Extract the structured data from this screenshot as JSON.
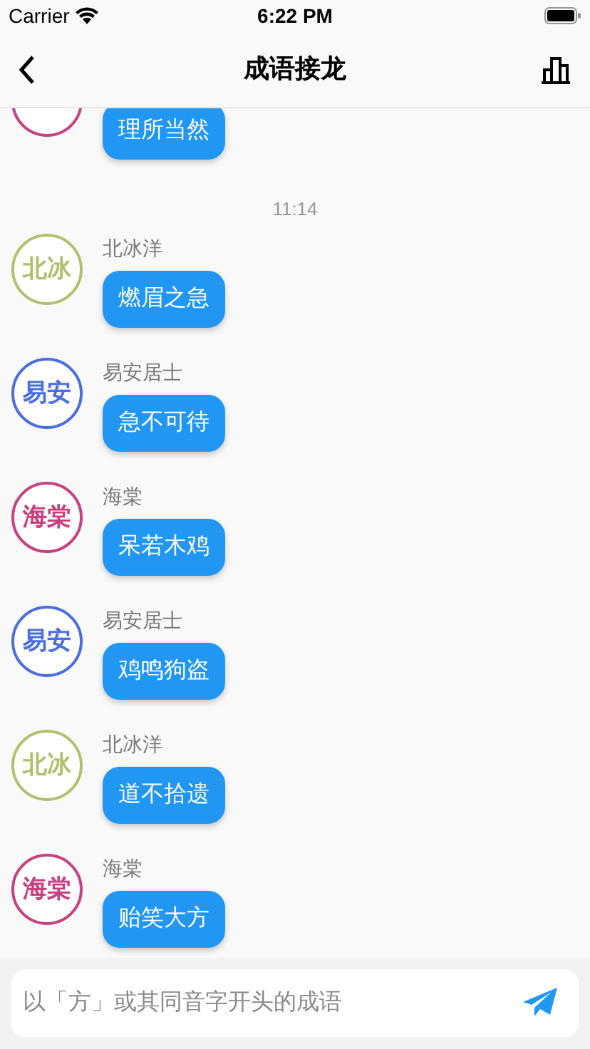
{
  "status_bar": {
    "carrier": "Carrier",
    "time": "6:22 PM"
  },
  "nav": {
    "title": "成语接龙"
  },
  "messages": [
    {
      "kind": "partial",
      "color": "#c8407f",
      "text": "理所当然"
    },
    {
      "kind": "time",
      "text": "11:14"
    },
    {
      "kind": "message",
      "avatar": "北冰",
      "name": "北冰洋",
      "color": "#b3bf6e",
      "text": "燃眉之急"
    },
    {
      "kind": "message",
      "avatar": "易安",
      "name": "易安居士",
      "color": "#4a6ee0",
      "text": "急不可待"
    },
    {
      "kind": "message",
      "avatar": "海棠",
      "name": "海棠",
      "color": "#c8407f",
      "text": "呆若木鸡"
    },
    {
      "kind": "message",
      "avatar": "易安",
      "name": "易安居士",
      "color": "#4a6ee0",
      "text": "鸡鸣狗盗"
    },
    {
      "kind": "message",
      "avatar": "北冰",
      "name": "北冰洋",
      "color": "#b3bf6e",
      "text": "道不拾遗"
    },
    {
      "kind": "message",
      "avatar": "海棠",
      "name": "海棠",
      "color": "#c8407f",
      "text": "贻笑大方"
    }
  ],
  "input": {
    "placeholder": "以「方」或其同音字开头的成语"
  }
}
